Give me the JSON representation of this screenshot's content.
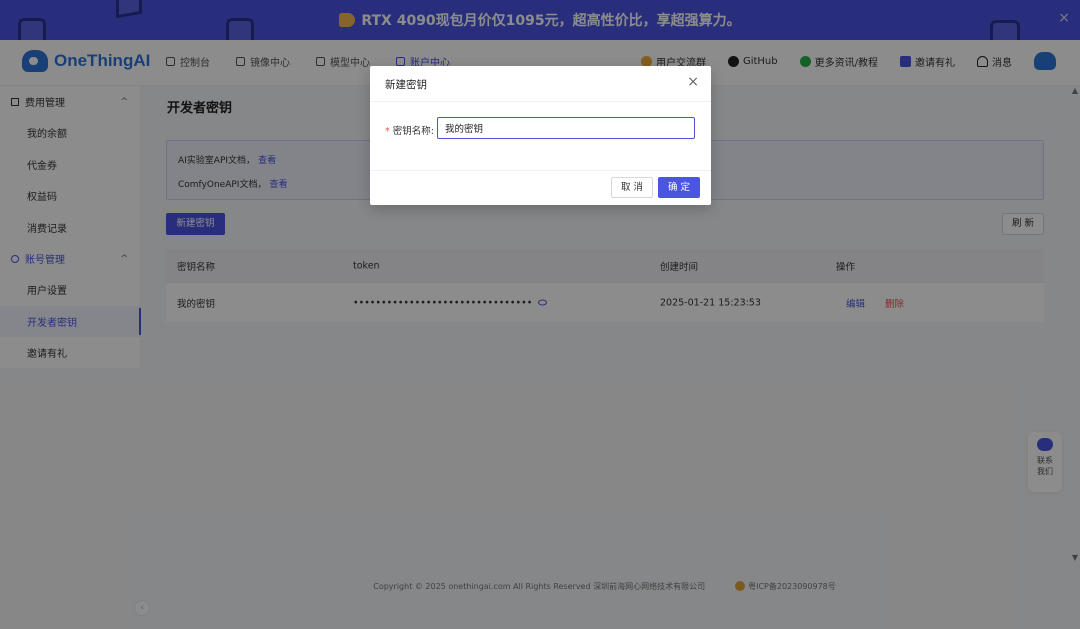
{
  "banner": {
    "text": "RTX 4090现包月价仅1095元，超高性价比，享超强算力。",
    "close": "×"
  },
  "nav": {
    "logo": "OneThingAI",
    "items": [
      {
        "label": "控制台",
        "active": false
      },
      {
        "label": "镜像中心",
        "active": false
      },
      {
        "label": "模型中心",
        "active": false
      },
      {
        "label": "账户中心",
        "active": true
      }
    ],
    "right": [
      {
        "label": "用户交流群",
        "icon": "chat-group-icon"
      },
      {
        "label": "GitHub",
        "icon": "github-icon"
      },
      {
        "label": "更多资讯/教程",
        "icon": "news-icon"
      },
      {
        "label": "邀请有礼",
        "icon": "gift-icon"
      },
      {
        "label": "消息",
        "icon": "bell-icon"
      }
    ]
  },
  "sidebar": {
    "groups": [
      {
        "label": "费用管理",
        "caret": "^",
        "items": [
          "我的余额",
          "代金券",
          "权益码",
          "消费记录"
        ]
      },
      {
        "label": "账号管理",
        "caret": "^",
        "items": [
          "用户设置",
          "开发者密钥",
          "邀请有礼"
        ]
      }
    ],
    "active_item": "开发者密钥",
    "collapse": "‹"
  },
  "main": {
    "title": "开发者密钥",
    "info": [
      {
        "text": "AI实验室API文档，",
        "link": "查看"
      },
      {
        "text": "ComfyOneAPI文档，",
        "link": "查看"
      }
    ],
    "new_key_button": "新建密钥",
    "refresh_button": "刷 新",
    "table": {
      "headers": [
        "密钥名称",
        "token",
        "创建时间",
        "操作"
      ],
      "rows": [
        {
          "name": "我的密钥",
          "token": "••••••••••••••••••••••••••••••••",
          "created": "2025-01-21 15:23:53",
          "edit": "编辑",
          "delete": "删除"
        }
      ]
    }
  },
  "footer": {
    "copyright": "Copyright © 2025 onethingai.com All Rights Reserved 深圳前海网心网络技术有限公司",
    "icp": "粤ICP备2023090978号"
  },
  "contact": {
    "label_line1": "联系",
    "label_line2": "我们"
  },
  "modal": {
    "title": "新建密钥",
    "close": "×",
    "field_label": "密钥名称:",
    "required_mark": "*",
    "field_value": "我的密钥",
    "cancel": "取 消",
    "confirm": "确 定"
  },
  "colors": {
    "primary": "#4a55e0",
    "danger": "#e8504a",
    "banner": "#4a55e0"
  }
}
